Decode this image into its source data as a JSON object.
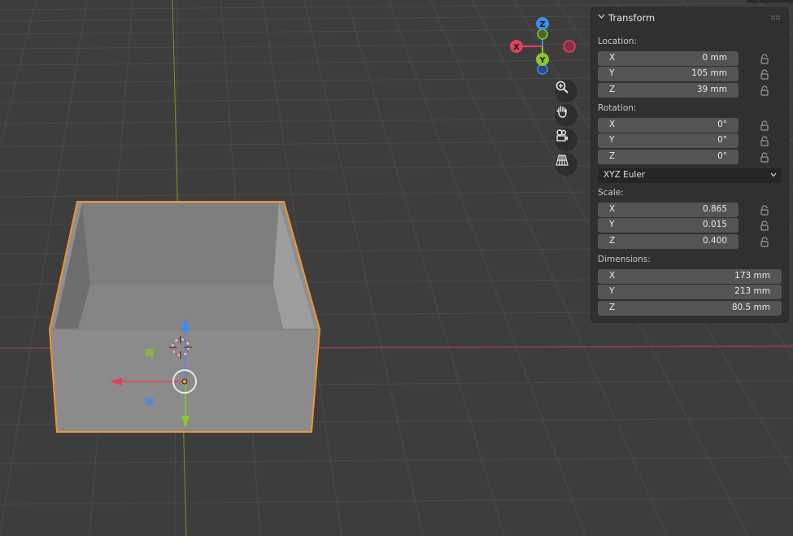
{
  "colors": {
    "viewport_bg": "#3d3d3d",
    "grid": "#4a4a4a",
    "x_axis": "#b4404a",
    "y_axis": "#6c9a28",
    "selection_outline": "#f0952e",
    "gizmo_x": "#e0435a",
    "gizmo_y": "#8bc82a",
    "gizmo_z": "#3d8cf0"
  },
  "gizmo": {
    "x": "X",
    "y": "Y",
    "z": "Z"
  },
  "nav_icons": [
    "zoom-icon",
    "pan-hand-icon",
    "camera-icon",
    "perspective-grid-icon"
  ],
  "panel": {
    "title": "Transform",
    "location": {
      "label": "Location:",
      "rows": [
        {
          "axis": "X",
          "value": "0 mm"
        },
        {
          "axis": "Y",
          "value": "105 mm"
        },
        {
          "axis": "Z",
          "value": "39 mm"
        }
      ]
    },
    "rotation": {
      "label": "Rotation:",
      "rows": [
        {
          "axis": "X",
          "value": "0°"
        },
        {
          "axis": "Y",
          "value": "0°"
        },
        {
          "axis": "Z",
          "value": "0°"
        }
      ],
      "mode": "XYZ Euler"
    },
    "scale": {
      "label": "Scale:",
      "rows": [
        {
          "axis": "X",
          "value": "0.865"
        },
        {
          "axis": "Y",
          "value": "0.015"
        },
        {
          "axis": "Z",
          "value": "0.400"
        }
      ]
    },
    "dimensions": {
      "label": "Dimensions:",
      "rows": [
        {
          "axis": "X",
          "value": "173 mm"
        },
        {
          "axis": "Y",
          "value": "213 mm"
        },
        {
          "axis": "Z",
          "value": "80.5 mm"
        }
      ]
    }
  }
}
